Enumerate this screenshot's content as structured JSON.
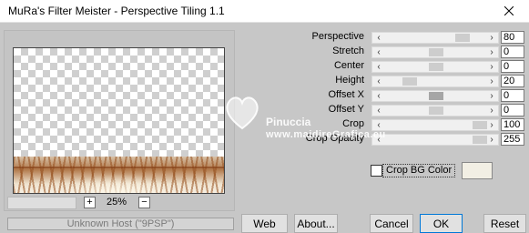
{
  "window": {
    "title": "MuRa's Filter Meister - Perspective Tiling 1.1"
  },
  "params": [
    {
      "label": "Perspective",
      "value": "80",
      "level": 0.8
    },
    {
      "label": "Stretch",
      "value": "0",
      "level": 0.5
    },
    {
      "label": "Center",
      "value": "0",
      "level": 0.5
    },
    {
      "label": "Height",
      "value": "20",
      "level": 0.2
    },
    {
      "label": "Offset X",
      "value": "0",
      "level": 0.5
    },
    {
      "label": "Offset Y",
      "value": "0",
      "level": 0.5
    },
    {
      "label": "Crop",
      "value": "100",
      "level": 1.0
    },
    {
      "label": "Crop Opacity",
      "value": "255",
      "level": 1.0
    }
  ],
  "crop_bg": {
    "label": "Crop BG Color",
    "checked": false,
    "color": "#f2efe4"
  },
  "zoom": {
    "plus": "+",
    "minus": "−",
    "value": "25%"
  },
  "status": {
    "text": "Unknown Host (\"9PSP\")"
  },
  "buttons": {
    "web": "Web",
    "about": "About...",
    "cancel": "Cancel",
    "ok": "OK",
    "reset": "Reset"
  },
  "watermark": {
    "line1": "Pinuccia",
    "line2": "www.maidireGrafica.eu"
  }
}
